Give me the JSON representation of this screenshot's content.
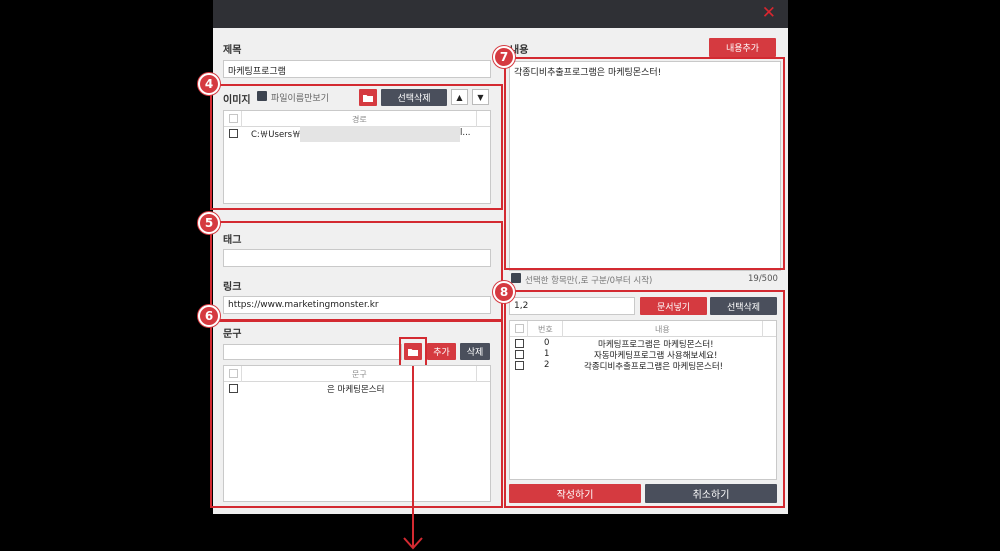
{
  "window": {
    "close_glyph": "✕"
  },
  "title_field": {
    "label": "제목",
    "value": "마케팅프로그램"
  },
  "images": {
    "label": "이미지",
    "filename_only_label": "파일이름만보기",
    "delete_selected": "선택삭제",
    "up": "▲",
    "down": "▼",
    "column_path": "경로",
    "rows": [
      {
        "path": "C:￦Users￦",
        "suffix": "l..."
      }
    ]
  },
  "tag": {
    "label": "태그",
    "value": ""
  },
  "link": {
    "label": "링크",
    "value": "https://www.marketingmonster.kr"
  },
  "phrase": {
    "label": "문구",
    "value": "",
    "add": "추가",
    "delete": "삭제",
    "column": "문구",
    "rows": [
      {
        "text": "은 마케팅몬스터"
      }
    ]
  },
  "content": {
    "label": "내용",
    "add_button": "내용추가",
    "text": "각종디비추출프로그램은 마케팅몬스터!",
    "hint": "선택한 항목만(,로 구분/0부터 시작)",
    "counter": "19/500"
  },
  "docs": {
    "input_value": "1,2",
    "fetch_button": "문서넣기",
    "delete_selected": "선택삭제",
    "col_number": "번호",
    "col_content": "내용",
    "rows": [
      {
        "num": "0",
        "text": "마케팅프로그램은 마케팅몬스터!"
      },
      {
        "num": "1",
        "text": "자동마케팅프로그램 사용해보세요!"
      },
      {
        "num": "2",
        "text": "각종디비추출프로그램은 마케팅몬스터!"
      }
    ],
    "write_button": "작성하기",
    "cancel_button": "취소하기"
  },
  "badges": {
    "b4": "4",
    "b5": "5",
    "b6": "6",
    "b7": "7",
    "b8": "8"
  },
  "colors": {
    "accent": "#d53a40",
    "dark_button": "#4a4f5c",
    "titlebar": "#2f3035"
  }
}
